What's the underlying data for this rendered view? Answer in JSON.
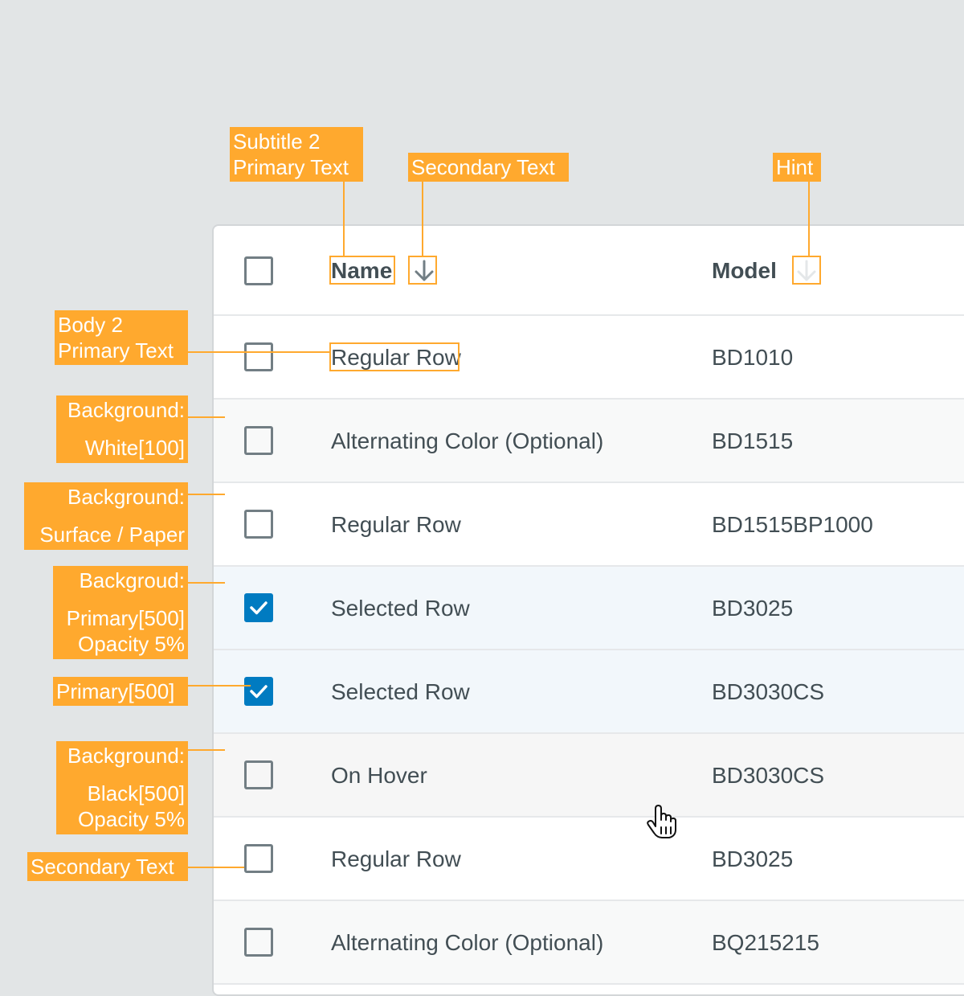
{
  "colors": {
    "accent": "#ffa92e",
    "primary": "#007bc1",
    "page_background": "#e2e5e6",
    "surface": "#ffffff",
    "alternating_row": "#f8f9f9",
    "selected_row": "#f2f7fb",
    "hover_row": "#f6f6f6",
    "text_primary": "#424e54",
    "checkbox_border": "#727e84"
  },
  "table": {
    "header": {
      "name_label": "Name",
      "model_label": "Model",
      "name_sort_icon": "arrow-down-icon",
      "model_sort_icon": "arrow-down-icon-hint"
    },
    "rows": [
      {
        "name": "Regular Row",
        "model": "BD1010",
        "checked": false,
        "state": "regular"
      },
      {
        "name": "Alternating Color (Optional)",
        "model": "BD1515",
        "checked": false,
        "state": "alternating"
      },
      {
        "name": "Regular Row",
        "model": "BD1515BP1000",
        "checked": false,
        "state": "regular"
      },
      {
        "name": "Selected Row",
        "model": "BD3025",
        "checked": true,
        "state": "selected"
      },
      {
        "name": "Selected Row",
        "model": "BD3030CS",
        "checked": true,
        "state": "selected"
      },
      {
        "name": "On Hover",
        "model": "BD3030CS",
        "checked": false,
        "state": "hover"
      },
      {
        "name": "Regular Row",
        "model": "BD3025",
        "checked": false,
        "state": "regular"
      },
      {
        "name": "Alternating Color (Optional)",
        "model": "BQ215215",
        "checked": false,
        "state": "alternating"
      }
    ]
  },
  "annotations": {
    "subtitle": [
      "Subtitle 2",
      "Primary Text"
    ],
    "secondary_top": "Secondary Text",
    "hint": "Hint",
    "body": [
      "Body 2",
      "Primary Text"
    ],
    "bg_white": [
      "Background:",
      "White[100]"
    ],
    "bg_surface": [
      "Background:",
      "Surface / Paper"
    ],
    "bg_primary": [
      "Backgroud:",
      "Primary[500]",
      "Opacity 5%"
    ],
    "primary": "Primary[500]",
    "bg_black": [
      "Background:",
      "Black[500]",
      "Opacity 5%"
    ],
    "secondary_bottom": "Secondary Text"
  },
  "cursor_icon": "hand-pointer-icon"
}
